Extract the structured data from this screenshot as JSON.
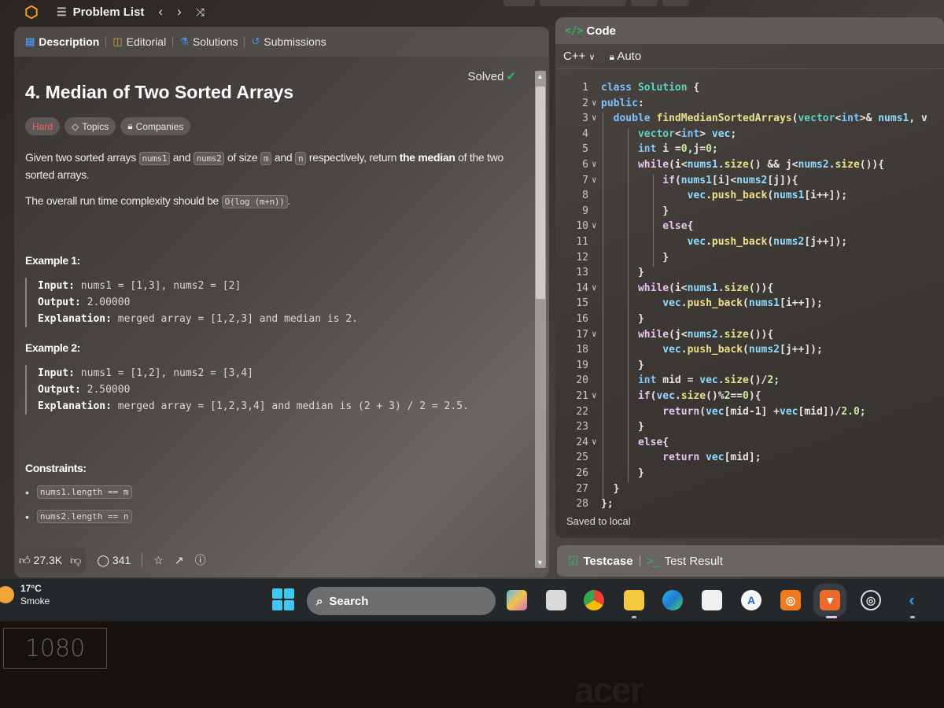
{
  "topnav": {
    "problem_list": "Problem List",
    "prev_icon": "chevron-left",
    "next_icon": "chevron-right",
    "shuffle_icon": "shuffle"
  },
  "left": {
    "tabs": [
      {
        "label": "Description",
        "icon": "document",
        "active": true
      },
      {
        "label": "Editorial",
        "icon": "book"
      },
      {
        "label": "Solutions",
        "icon": "flask"
      },
      {
        "label": "Submissions",
        "icon": "history"
      }
    ],
    "title": "4. Median of Two Sorted Arrays",
    "status": "Solved",
    "difficulty": "Hard",
    "topics": "Topics",
    "companies": "Companies",
    "desc": {
      "p1_a": "Given two sorted arrays ",
      "c1": "nums1",
      "p1_b": " and ",
      "c2": "nums2",
      "p1_c": " of size ",
      "c3": "m",
      "p1_d": " and ",
      "c4": "n",
      "p1_e": " respectively, return ",
      "p1_bold": "the median",
      "p1_f": " of the two sorted arrays.",
      "p2_a": "The overall run time complexity should be ",
      "c5": "O(log (m+n))",
      "p2_b": "."
    },
    "examples": [
      {
        "heading": "Example 1:",
        "input_label": "Input:",
        "input": " nums1 = [1,3], nums2 = [2]",
        "output_label": "Output:",
        "output": " 2.00000",
        "expl_label": "Explanation:",
        "expl": " merged array = [1,2,3] and median is 2."
      },
      {
        "heading": "Example 2:",
        "input_label": "Input:",
        "input": " nums1 = [1,2], nums2 = [3,4]",
        "output_label": "Output:",
        "output": " 2.50000",
        "expl_label": "Explanation:",
        "expl": " merged array = [1,2,3,4] and median is (2 + 3) / 2 = 2.5."
      }
    ],
    "constraints_heading": "Constraints:",
    "constraints": [
      "nums1.length == m",
      "nums2.length == n"
    ],
    "footer": {
      "likes": "27.3K",
      "comments": "341"
    }
  },
  "right": {
    "header": "Code",
    "language": "C++",
    "mode": "Auto",
    "saved": "Saved to local",
    "code_lines": [
      "class Solution {",
      "public:",
      "    double findMedianSortedArrays(vector<int>& nums1, v",
      "        vector<int> vec;",
      "        int i =0,j=0;",
      "        while(i<nums1.size() && j<nums2.size()){",
      "            if(nums1[i]<nums2[j]){",
      "                vec.push_back(nums1[i++]);",
      "            }",
      "            else{",
      "                vec.push_back(nums2[j++]);",
      "            }",
      "        }",
      "        while(i<nums1.size()){",
      "            vec.push_back(nums1[i++]);",
      "        }",
      "        while(j<nums2.size()){",
      "            vec.push_back(nums2[j++]);",
      "        }",
      "        int mid = vec.size()/2;",
      "        if(vec.size()%2==0){",
      "            return(vec[mid-1] +vec[mid])/2.0;",
      "        }",
      "        else{",
      "            return vec[mid];",
      "        }",
      "    }",
      "};"
    ],
    "fold_lines": [
      2,
      3,
      6,
      7,
      10,
      14,
      17,
      21,
      24
    ],
    "testcase": "Testcase",
    "test_result": "Test Result"
  },
  "taskbar": {
    "weather_temp": "17°C",
    "weather_desc": "Smoke",
    "search": "Search",
    "apps": [
      "widgets",
      "copilot",
      "task-view",
      "chrome",
      "file-explorer",
      "edge",
      "microsoft-store",
      "app-store",
      "ubuntu",
      "brave",
      "obs",
      "vscode"
    ]
  },
  "monitor": {
    "badge": "1080",
    "brand": "acer"
  }
}
